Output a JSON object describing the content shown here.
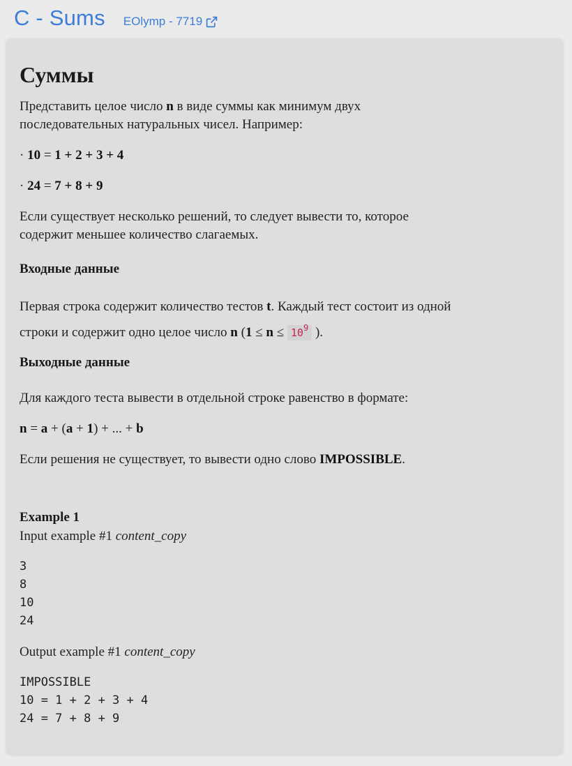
{
  "header": {
    "title": "C - Sums",
    "source_link": "EOlymp - 7719",
    "source_icon": "external-link-icon"
  },
  "problem": {
    "title": "Суммы",
    "intro_1": "Представить целое число ",
    "intro_n": "n",
    "intro_2": " в виде суммы как минимум двух",
    "intro_line2": "последовательных натуральных чисел. Например:",
    "bullet_char": "·",
    "example1_lhs": "10",
    "example1_eq": " = ",
    "example1_rhs": "1 + 2 + 3 + 4",
    "example2_lhs": "24",
    "example2_eq": " = ",
    "example2_rhs": "7 + 8 + 9",
    "multi_line1": "Если существует несколько решений, то следует вывести то, которое",
    "multi_line2": "содержит меньшее количество слагаемых.",
    "input_heading": "Входные данные",
    "input_1": "Первая строка содержит количество тестов ",
    "input_t": "t",
    "input_2": ". Каждый тест состоит из одной",
    "input_3": "строки и содержит одно целое число ",
    "input_n": "n",
    "input_4": " (",
    "input_one": "1",
    "input_le1": " ≤ ",
    "input_n2": "n",
    "input_le2": " ≤ ",
    "input_code_base": "10",
    "input_code_exp": "9",
    "input_5": " ).",
    "output_heading": "Выходные данные",
    "output_line": "Для каждого теста вывести в отдельной строке равенство в формате:",
    "format_n": "n",
    "format_1": " = ",
    "format_a": "a",
    "format_2": " + (",
    "format_a2": "a",
    "format_3": " + ",
    "format_one": "1",
    "format_4": ") + ... + ",
    "format_b": "b",
    "impossible_1": "Если решения не существует, то вывести одно слово ",
    "impossible_word": "IMPOSSIBLE",
    "impossible_2": "."
  },
  "examples": {
    "heading": "Example 1",
    "input_label": "Input example #1",
    "output_label": "Output example #1",
    "copy_icon_text": "content_copy",
    "copy_icon": "content-copy-icon",
    "input_lines": [
      "3",
      "8",
      "10",
      "24"
    ],
    "output_lines": [
      "IMPOSSIBLE",
      "10 = 1 + 2 + 3 + 4",
      "24 = 7 + 8 + 9"
    ]
  },
  "colors": {
    "accent": "#3b7dd8",
    "page_background": "#ebebeb",
    "card_background": "#dedede",
    "inline_code": "#c7254e"
  }
}
